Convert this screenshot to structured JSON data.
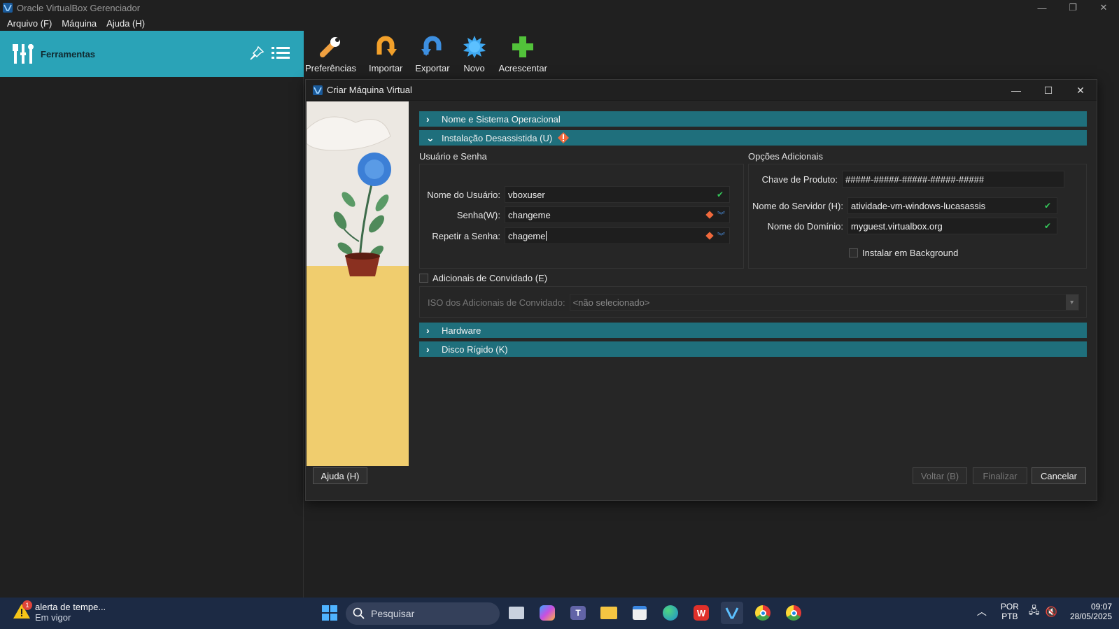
{
  "window": {
    "title": "Oracle VirtualBox Gerenciador",
    "controls": {
      "minimize": "—",
      "restore": "❐",
      "close": "✕"
    }
  },
  "menu": {
    "items": [
      "Arquivo (F)",
      "Máquina",
      "Ajuda (H)"
    ]
  },
  "sidebar": {
    "tools_label": "Ferramentas"
  },
  "toolbar": {
    "preferences": "Preferências",
    "import": "Importar",
    "export": "Exportar",
    "new": "Novo",
    "add": "Acrescentar"
  },
  "dialog": {
    "title": "Criar Máquina Virtual",
    "controls": {
      "minimize": "—",
      "maximize": "☐",
      "close": "✕"
    },
    "sections": {
      "name_os": "Nome e Sistema Operacional",
      "unattended": "Instalação Desassistida (U)",
      "hardware": "Hardware",
      "disk": "Disco Rígido (K)"
    },
    "user_group": {
      "title": "Usuário e Senha",
      "username_label": "Nome do Usuário:",
      "username_value": "vboxuser",
      "password_label": "Senha(W):",
      "password_value": "changeme",
      "repeat_label": "Repetir a Senha:",
      "repeat_value": "chageme"
    },
    "extra_group": {
      "title": "Opções Adicionais",
      "product_key_label": "Chave de Produto:",
      "product_key_value": "#####-#####-#####-#####-#####",
      "hostname_label": "Nome do Servidor (H):",
      "hostname_value": "atividade-vm-windows-lucasassis",
      "domain_label": "Nome do Domínio:",
      "domain_value": "myguest.virtualbox.org",
      "background_label": "Instalar em Background"
    },
    "guest_additions": {
      "checkbox_label": "Adicionais de Convidado (E)",
      "iso_label": "ISO dos Adicionais de Convidado:",
      "iso_value": "<não selecionado>"
    },
    "buttons": {
      "help": "Ajuda (H)",
      "back": "Voltar (B)",
      "finish": "Finalizar",
      "cancel": "Cancelar"
    }
  },
  "taskbar": {
    "weather_badge": "1",
    "weather_title": "alerta de tempe...",
    "weather_sub": "Em vigor",
    "search_placeholder": "Pesquisar",
    "lang_1": "POR",
    "lang_2": "PTB",
    "time": "09:07",
    "date": "28/05/2025"
  },
  "colors": {
    "accent": "#2aa3b7",
    "section": "#1f6f7c",
    "warning": "#f0693c",
    "ok": "#34c759"
  }
}
